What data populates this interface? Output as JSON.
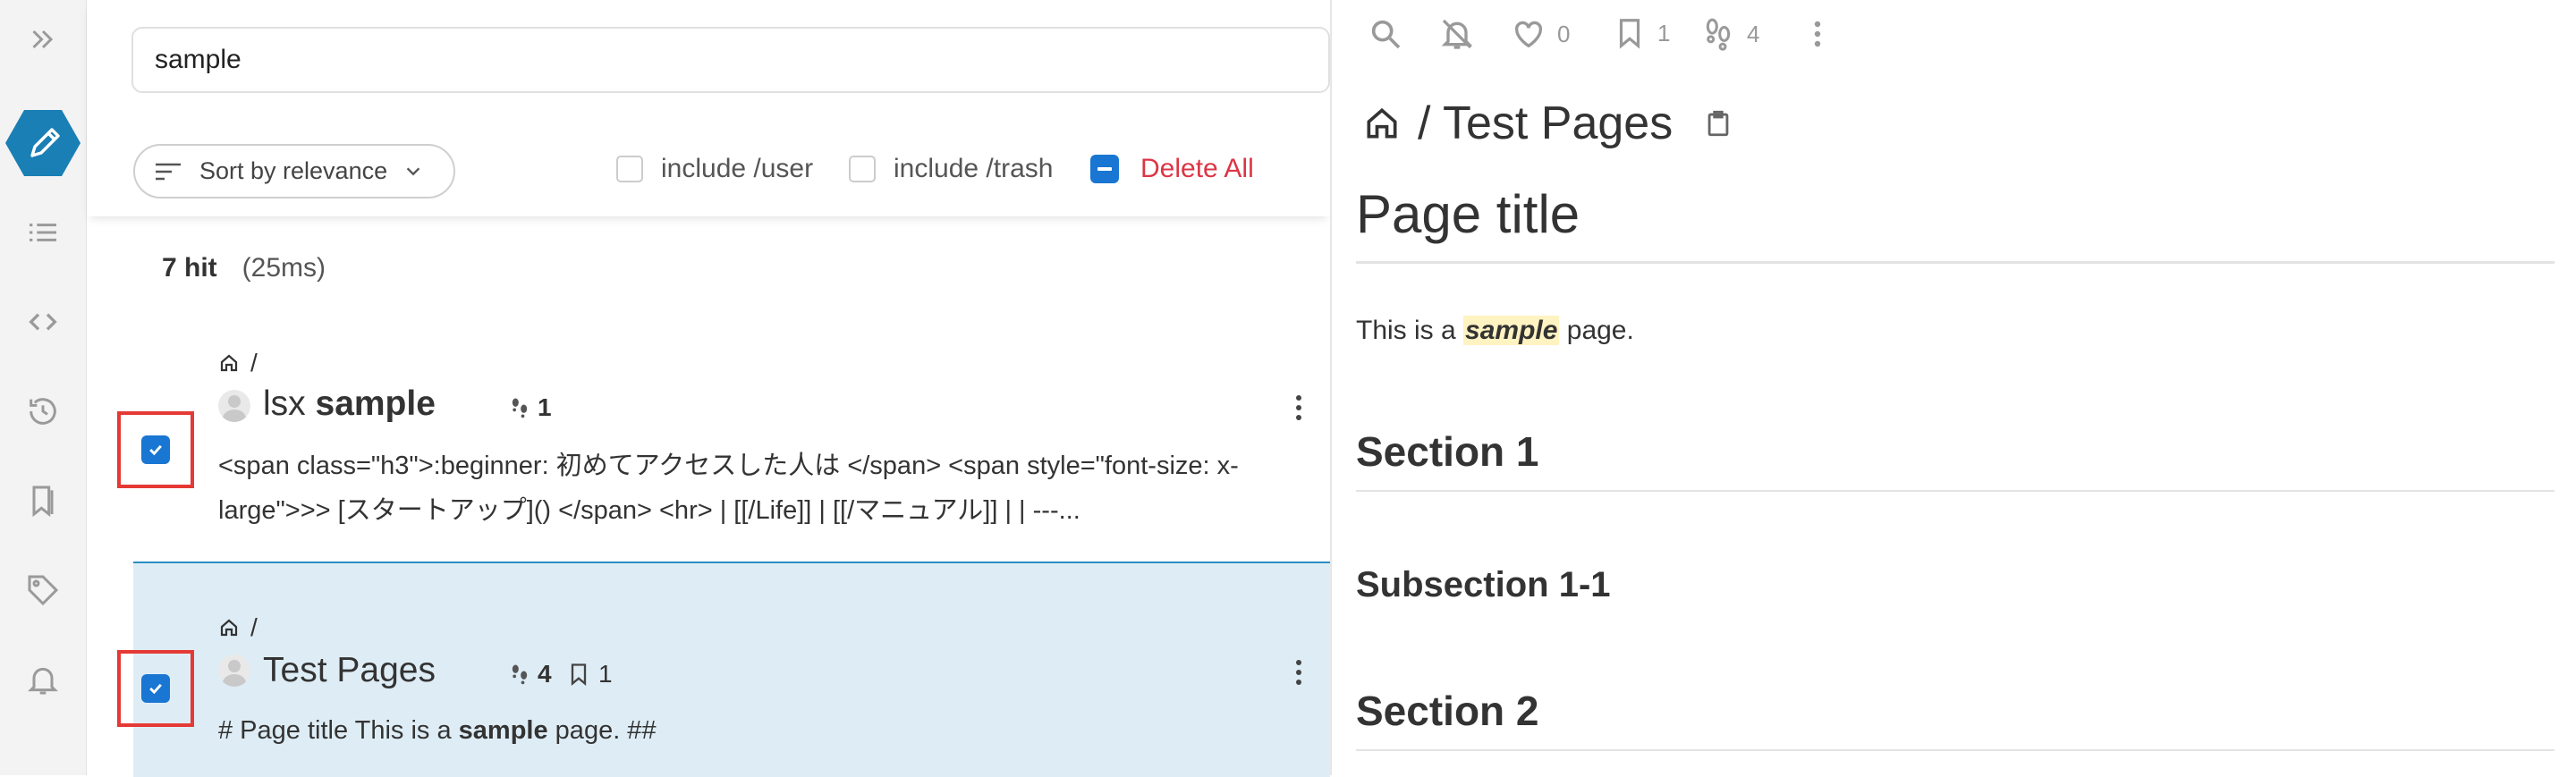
{
  "sidebar": {
    "items": [
      {
        "name": "collapse",
        "icon": "double-chevron-right-icon"
      },
      {
        "name": "edit",
        "icon": "pencil-icon",
        "active": true,
        "color": "#1a7fb5"
      },
      {
        "name": "page-tree",
        "icon": "list-icon"
      },
      {
        "name": "custom-sidebar",
        "icon": "code-icon"
      },
      {
        "name": "recent-changes",
        "icon": "history-icon"
      },
      {
        "name": "bookmarks",
        "icon": "bookmarks-icon"
      },
      {
        "name": "tags",
        "icon": "tag-icon"
      },
      {
        "name": "in-app-notification",
        "icon": "bell-icon"
      }
    ]
  },
  "search": {
    "query": "sample",
    "sort_label": "Sort by relevance",
    "include_user_label": "include /user",
    "include_trash_label": "include /trash",
    "delete_all_label": "Delete All",
    "hit_count": "7 hit",
    "time": "(25ms)"
  },
  "results": [
    {
      "path": "/",
      "title_pre": "lsx ",
      "title_hl": "sample",
      "seen_count": "1",
      "snippet": "<span class=\"h3\">:beginner: 初めてアクセスした人は </span> <span style=\"font-size: x-large\">>> [スタートアップ]() </span> <hr> | [[/Life]] | [[/マニュアル]] | | ---...",
      "checked": true
    },
    {
      "path": "/",
      "title_pre": "Test Pages",
      "seen_count": "4",
      "bookmark_count": "1",
      "snippet_pre": "# Page title This is a ",
      "snippet_hl": "sample",
      "snippet_post": " page. ##",
      "checked": true,
      "selected": true
    }
  ],
  "preview": {
    "toolbar": {
      "like_count": "0",
      "bookmark_count": "1",
      "seen_count": "4"
    },
    "path_text": "/ Test Pages",
    "h1": "Page title",
    "paragraph_pre": "This is a ",
    "paragraph_mark": "sample",
    "paragraph_post": " page.",
    "section1": "Section 1",
    "subsection": "Subsection 1-1",
    "section2": "Section 2"
  }
}
